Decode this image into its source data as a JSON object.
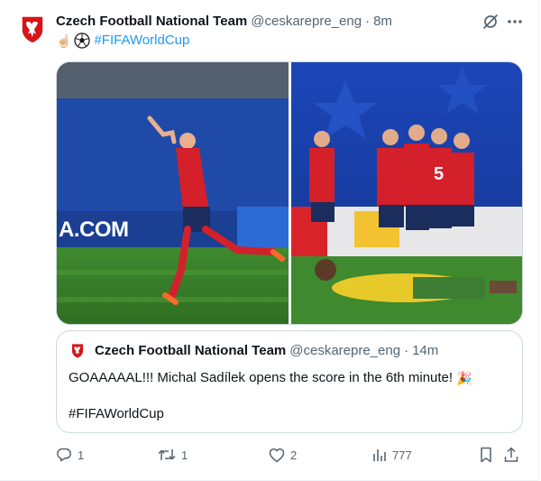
{
  "tweet": {
    "author_name": "Czech Football National Team",
    "handle": "@ceskarepre_eng",
    "separator": "·",
    "time": "8m",
    "text_hashtag": "#FIFAWorldCup",
    "emoji_hand": "☝🏻",
    "media": {
      "left_photo_board_text": "A.COM"
    }
  },
  "quote": {
    "author_name": "Czech Football National Team",
    "handle": "@ceskarepre_eng",
    "separator": "·",
    "time": "14m",
    "text": "GOAAAAAL!!! Michal Sadílek opens the score in the 6th minute!",
    "emoji": "🎉",
    "hashtag": "#FIFAWorldCup"
  },
  "actions": {
    "replies": "1",
    "reposts": "1",
    "likes": "2",
    "views": "777"
  },
  "icons": {
    "avatar": "czech-crest-icon",
    "grok": "grok-icon",
    "more": "more-icon",
    "reply": "reply-icon",
    "repost": "repost-icon",
    "like": "heart-icon",
    "views": "views-icon",
    "bookmark": "bookmark-icon",
    "share": "share-icon"
  },
  "colors": {
    "accent": "#1d9bf0",
    "secondary_text": "#536471",
    "border": "#cfd9de",
    "crest_red": "#d7141a"
  }
}
